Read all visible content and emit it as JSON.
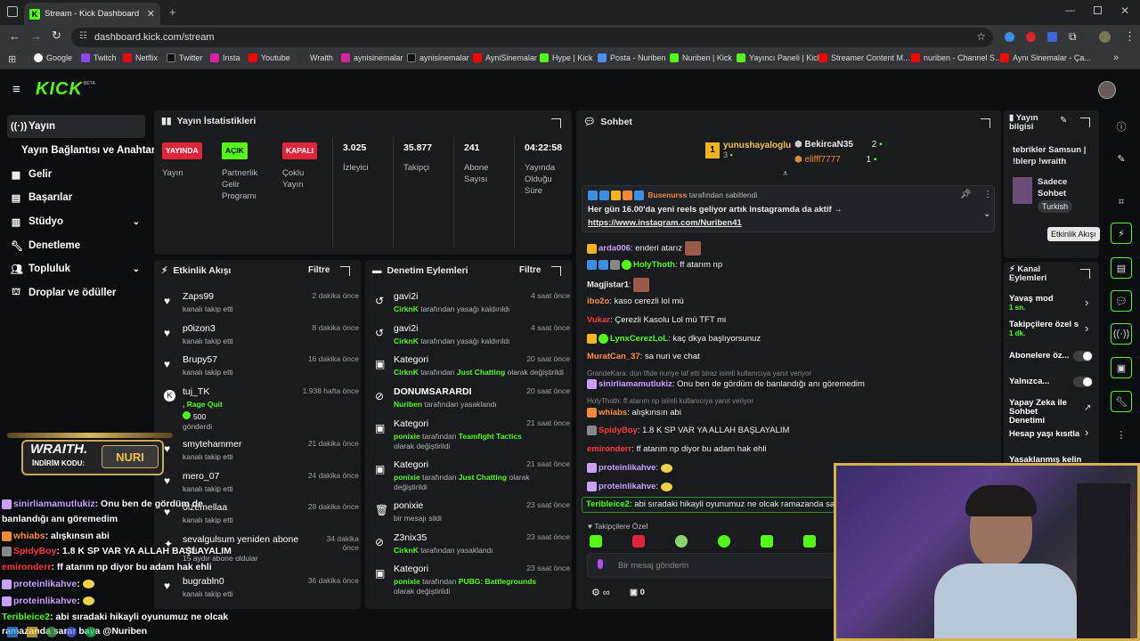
{
  "browser": {
    "tab_title": "Stream - Kick Dashboard",
    "url": "dashboard.kick.com/stream",
    "bookmarks": [
      "Google",
      "Twitch",
      "Netflix",
      "Twitter",
      "Insta",
      "Youtube",
      "Wraith",
      "aynisinemalar",
      "aynisinemalar",
      "AyniSinemalar",
      "Hype | Kick",
      "Posta - Nuriben",
      "Nuriben | Kick",
      "Yayıncı Paneli | Kick",
      "Streamer Content M...",
      "nuriben - Channel S...",
      "Aynı Sinemalar - Ça..."
    ]
  },
  "brand": {
    "logo": "KICK",
    "beta": "BETA",
    "accent": "#53fc18"
  },
  "sidebar": {
    "items": [
      {
        "label": "Yayın",
        "icon": "broadcast-icon"
      },
      {
        "label": "Yayın Bağlantısı ve Anahtarı",
        "icon": ""
      },
      {
        "label": "Gelir",
        "icon": "revenue-icon"
      },
      {
        "label": "Başarılar",
        "icon": "achievements-icon"
      },
      {
        "label": "Stüdyo",
        "icon": "studio-icon"
      },
      {
        "label": "Denetleme",
        "icon": "wrench-icon"
      },
      {
        "label": "Topluluk",
        "icon": "community-icon"
      },
      {
        "label": "Droplar ve ödüller",
        "icon": "gift-icon"
      }
    ]
  },
  "stats": {
    "title": "Yayın İstatistikleri",
    "badges": [
      {
        "badge": "YAYINDA",
        "label": "Yayın",
        "color": "#e0243a",
        "text_color": "#fff"
      },
      {
        "badge": "AÇIK",
        "label": "Partnerlik Gelir Programı",
        "color": "#53fc18",
        "text_color": "#000"
      },
      {
        "badge": "KAPALI",
        "label": "Çoklu Yayın",
        "color": "#e0243a",
        "text_color": "#fff"
      }
    ],
    "metrics": [
      {
        "value": "3.025",
        "label": "İzleyici"
      },
      {
        "value": "35.877",
        "label": "Takipçi"
      },
      {
        "value": "241",
        "label": "Abone Sayısı"
      },
      {
        "value": "04:22:58",
        "label": "Yayında Olduğu Süre"
      }
    ]
  },
  "activity": {
    "title": "Etkinlik Akışı",
    "filter": "Filtre",
    "items": [
      {
        "name": "Zaps99",
        "sub": "kanalı takip etti",
        "time": "2 dakika önce"
      },
      {
        "name": "p0izon3",
        "sub": "kanalı takip etti",
        "time": "8 dakika önce"
      },
      {
        "name": "Brupy57",
        "sub": "kanalı takip etti",
        "time": "16 dakika önce"
      },
      {
        "name": "tuj_TK",
        "sub": ", Rage Quit",
        "amount": "500",
        "sub2": "gönderdi",
        "time": "1.938 hafta önce"
      },
      {
        "name": "smytehammer",
        "sub": "kanalı takip etti",
        "time": "21 dakika önce"
      },
      {
        "name": "mero_07",
        "sub": "kanalı takip etti",
        "time": "24 dakika önce"
      },
      {
        "name": "0lzemellaa",
        "sub": "kanalı takip etti",
        "time": "28 dakika önce"
      },
      {
        "name": "sevalgulsum yeniden abone oldu",
        "sub": "15 aydır abone oldular",
        "time": "34 dakika önce"
      },
      {
        "name": "bugrabln0",
        "sub": "kanalı takip etti",
        "time": "36 dakika önce"
      }
    ]
  },
  "moderation": {
    "title": "Denetim Eylemleri",
    "filter": "Filtre",
    "items": [
      {
        "name": "gavi2i",
        "actor": "CirknK",
        "text": "tarafından yasağı kaldırıldı",
        "time": "4 saat önce"
      },
      {
        "name": "gavi2i",
        "actor": "CirknK",
        "text": "tarafından yasağı kaldırıldı",
        "time": "4 saat önce"
      },
      {
        "name": "Kategori",
        "actor": "CirknK",
        "text": "tarafından",
        "cat": "Just Chatting",
        "text2": "olarak değiştirildi",
        "time": "20 saat önce"
      },
      {
        "name": "DONUMSARARDI",
        "actor": "Nuriben",
        "text": "tarafından yasaklandı",
        "time": "20 saat önce"
      },
      {
        "name": "Kategori",
        "actor": "ponixie",
        "text": "tarafından",
        "cat": "Teamfight Tactics",
        "text2": "olarak değiştirildi",
        "time": "21 saat önce"
      },
      {
        "name": "Kategori",
        "actor": "ponixie",
        "text": "tarafından",
        "cat": "Just Chatting",
        "text2": "olarak değiştirildi",
        "time": "21 saat önce"
      },
      {
        "name": "ponixie",
        "actor": "",
        "text": "bir mesajı sildi",
        "time": "23 saat önce"
      },
      {
        "name": "Z3nix35",
        "actor": "CirknK",
        "text": "tarafından yasaklandı",
        "time": "23 saat önce"
      },
      {
        "name": "Kategori",
        "actor": "ponixie",
        "text": "tarafından",
        "cat": "PUBG: Battlegrounds",
        "text2": "olarak değiştirildi",
        "time": "23 saat önce"
      }
    ]
  },
  "chat": {
    "title": "Sohbet",
    "top_gifters": [
      {
        "name": "yunushayaloglu",
        "count": "3"
      },
      {
        "name": "BekircaN35",
        "count": "2"
      },
      {
        "name": "elifff7777",
        "count": "1"
      }
    ],
    "pinned": {
      "by": "Busenurss",
      "by_text": "tarafından sabitlendi",
      "text": "Her gün 16.00'da yeni reels geliyor artık instagramda da aktif →",
      "link": "https://www.instagram.com/Nuriben41"
    },
    "messages": [
      {
        "user": "arda006",
        "color": "#c9a0ff",
        "text": "enderi atarız"
      },
      {
        "user": "HolyThoth",
        "color": "#53fc18",
        "text": "ff atarım np"
      },
      {
        "user": "Magjistar1",
        "color": "#e8e8e8",
        "text": ""
      },
      {
        "user": "ibo2o",
        "color": "#ff8f3b",
        "text": "kaso cerezli lol mü"
      },
      {
        "user": "Vukar",
        "color": "#ff3b3b",
        "text": "Çerezli Kasolu Lol mü TFT mi"
      },
      {
        "user": "LynxCerezLoL",
        "color": "#53fc18",
        "text": "kaç dkya başlıyorsunuz"
      },
      {
        "user": "MuratCan_37",
        "color": "#ff8f3b",
        "text": "sa nuri ve chat"
      },
      {
        "user": "sinirliamamutlukiz",
        "color": "#c9a0ff",
        "text": "Onu ben de gördüm de banlandığı anı göremedim",
        "reply": "GrandeKara: dün tftde nuriye laf etti biraz isimli kullanıcıya yanıt veriyor"
      },
      {
        "user": "whiabs",
        "color": "#ff8f3b",
        "text": "alışkınsın abi",
        "reply": "HolyThoth: ff atarım np isimli kullanıcıya yanıt veriyor"
      },
      {
        "user": "SpidyBoy",
        "color": "#ff3b3b",
        "text": "1.8 K SP VAR YA ALLAH BAŞLAYALIM"
      },
      {
        "user": "emironderr",
        "color": "#ff3b3b",
        "text": "ff atarım np diyor bu adam hak ehli"
      },
      {
        "user": "proteinlikahve",
        "color": "#c9a0ff",
        "text": ""
      },
      {
        "user": "proteinlikahve",
        "color": "#c9a0ff",
        "text": ""
      },
      {
        "user": "Teribleice2",
        "color": "#53fc18",
        "text": "abi sıradaki hikayli oyunumuz ne olcak ramazanda sarar"
      }
    ],
    "followers_only": "Takipçilere Özel",
    "input_placeholder": "Bir mesaj gönderin",
    "count": "0"
  },
  "stream_info": {
    "title": "Yayın bilgisi",
    "stream_title": "tebrikler Samsun | !blerp !wraith",
    "category": "Sadece Sohbet",
    "tag": "Turkish"
  },
  "channel_actions": {
    "title": "Kanal Eylemleri",
    "items": [
      {
        "label": "Yavaş mod",
        "sub": "1 sn."
      },
      {
        "label": "Takipçilere özel s",
        "sub": "1 dk."
      },
      {
        "label": "Abonelere öz...",
        "sub": ""
      },
      {
        "label": "Yalnızca...",
        "sub": ""
      },
      {
        "label": "Yapay Zeka ile Sohbet Denetimi",
        "sub": ""
      },
      {
        "label": "Hesap yaşı kısıtla",
        "sub": ""
      },
      {
        "label": "Yasaklanmış kelin",
        "sub": ""
      }
    ]
  },
  "tooltip": "Etkinlik Akışı",
  "overlay": {
    "promo_brand": "WRAITH.",
    "promo_label": "İNDİRİM KODU:",
    "promo_code": "NURI",
    "lines": [
      {
        "user": "sinirliamamutlukiz",
        "color": "#c9a0ff",
        "text": ": Onu ben de gördüm de"
      },
      {
        "user": "",
        "color": "#fff",
        "text": "banlandığı anı göremedim"
      },
      {
        "user": "whiabs",
        "color": "#ff8f3b",
        "text": ": alışkınsın abi"
      },
      {
        "user": "SpidyBoy",
        "color": "#ff3b3b",
        "text": ": 1.8 K SP VAR YA ALLAH BAŞLAYALIM"
      },
      {
        "user": "emironderr",
        "color": "#ff3b3b",
        "text": ": ff atarım np diyor bu adam hak ehli"
      },
      {
        "user": "proteinlikahve",
        "color": "#c9a0ff",
        "text": ":"
      },
      {
        "user": "proteinlikahve",
        "color": "#c9a0ff",
        "text": ":"
      },
      {
        "user": "Teribleice2",
        "color": "#53fc18",
        "text": ": abi sıradaki hikayli oyunumuz ne olcak"
      },
      {
        "user": "",
        "color": "#fff",
        "text": "ramazanda sarar baya @Nuriben"
      }
    ]
  }
}
